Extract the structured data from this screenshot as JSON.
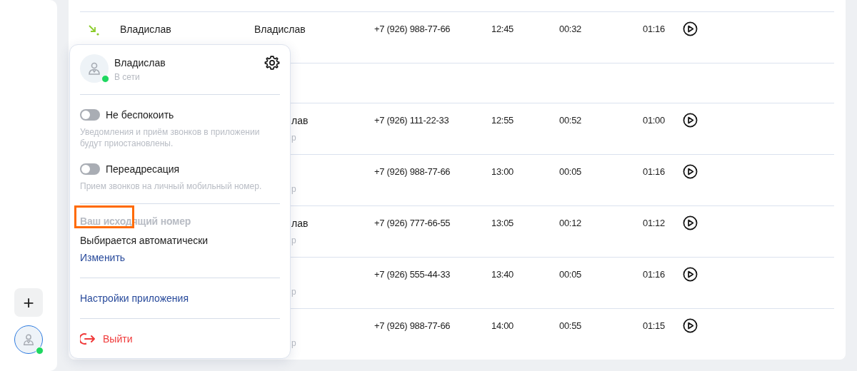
{
  "sidebar": {
    "add_button": "+",
    "user": {
      "online": true
    }
  },
  "calls": [
    {
      "kind": "incoming",
      "name": "Владислав",
      "contact": "Владислав",
      "phone": "+7 (926) 988-77-66",
      "time": "12:45",
      "duration": "00:32",
      "total": "01:16"
    },
    {
      "kind": "empty"
    },
    {
      "kind": "partial",
      "contact": "лав",
      "contact_sub": "р",
      "phone": "+7 (926) 111-22-33",
      "time": "12:55",
      "duration": "00:52",
      "total": "01:00"
    },
    {
      "kind": "partial",
      "contact_sub": "р",
      "phone": "+7 (926) 988-77-66",
      "time": "13:00",
      "duration": "00:05",
      "total": "01:16"
    },
    {
      "kind": "partial",
      "contact": "лав",
      "contact_sub": "р",
      "phone": "+7 (926) 777-66-55",
      "time": "13:05",
      "duration": "00:12",
      "total": "01:12"
    },
    {
      "kind": "partial",
      "contact_sub": "р",
      "phone": "+7 (926) 555-44-33",
      "time": "13:40",
      "duration": "00:05",
      "total": "01:16"
    },
    {
      "kind": "partial",
      "contact_sub": "р",
      "phone": "+7 (926) 988-77-66",
      "time": "14:00",
      "duration": "00:55",
      "total": "01:15"
    }
  ],
  "profile_menu": {
    "user": {
      "name": "Владислав",
      "status": "В сети",
      "online": true
    },
    "toggles": [
      {
        "label": "Не беспокоить",
        "description": "Уведомления и приём звонков в приложении будут приостановлены.",
        "on": false
      },
      {
        "label": "Переадресация",
        "description": "Прием звонков на личный мобильный номер.",
        "on": false
      }
    ],
    "outgoing_number": {
      "title": "Ваш исходящий номер",
      "highlighted": true,
      "value": "Выбирается автоматически",
      "change_link": "Изменить"
    },
    "settings_link": "Настройки приложения",
    "logout": "Выйти"
  }
}
